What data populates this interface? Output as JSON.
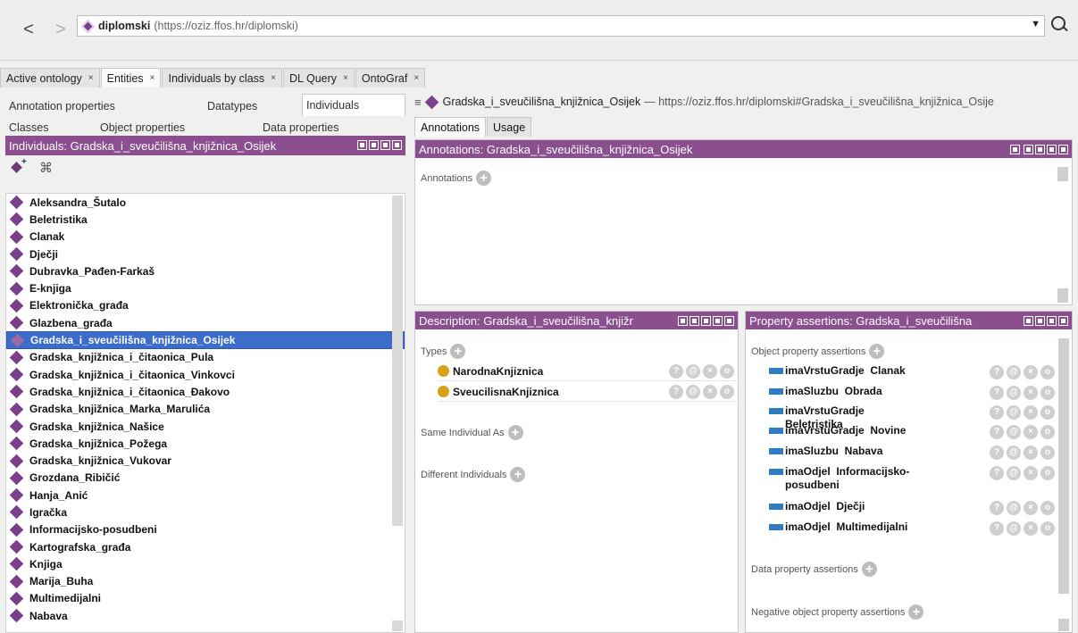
{
  "address": {
    "name": "diplomski",
    "iri": "(https://oziz.ffos.hr/diplomski)"
  },
  "tabs": [
    {
      "label": "Active ontology",
      "close": "×"
    },
    {
      "label": "Entities",
      "close": "×"
    },
    {
      "label": "Individuals by class",
      "close": "×"
    },
    {
      "label": "DL Query",
      "close": "×"
    },
    {
      "label": "OntoGraf",
      "close": "×"
    }
  ],
  "left": {
    "subtabs_row1": [
      "Annotation properties",
      "Datatypes",
      "Individuals"
    ],
    "subtabs_row2": [
      "Classes",
      "Object properties",
      "Data properties"
    ],
    "header": "Individuals: Gradska_i_sveučilišna_knjižnica_Osijek",
    "individuals": [
      "Aleksandra_Šutalo",
      "Beletristika",
      "Clanak",
      "Dječji",
      "Dubravka_Pađen-Farkaš",
      "E-knjiga",
      "Elektronička_građa",
      "Glazbena_građa",
      "Gradska_i_sveučilišna_knjižnica_Osijek",
      "Gradska_knjižnica_i_čitaonica_Pula",
      "Gradska_knjižnica_i_čitaonica_Vinkovci",
      "Gradska_knjižnica_i_čitaonica_Đakovo",
      "Gradska_knjižnica_Marka_Marulića",
      "Gradska_knjižnica_Našice",
      "Gradska_knjižnica_Požega",
      "Gradska_knjižnica_Vukovar",
      "Grozdana_Ribičić",
      "Hanja_Anić",
      "Igračka",
      "Informacijsko-posudbeni",
      "Kartografska_građa",
      "Knjiga",
      "Marija_Buha",
      "Multimedijalni",
      "Nabava"
    ],
    "selected_index": 8
  },
  "breadcrumb": {
    "name": "Gradska_i_sveučilišna_knjižnica_Osijek",
    "iri": "— https://oziz.ffos.hr/diplomski#Gradska_i_sveučilišna_knjižnica_Osije"
  },
  "right_tabs": [
    "Annotations",
    "Usage"
  ],
  "annotations": {
    "header": "Annotations: Gradska_i_sveučilišna_knjižnica_Osijek",
    "label": "Annotations"
  },
  "description": {
    "header": "Description: Gradska_i_sveučilišna_knjižr",
    "types_label": "Types",
    "types": [
      "NarodnaKnjiznica",
      "SveucilisnaKnjiznica"
    ],
    "same_label": "Same Individual As",
    "different_label": "Different Individuals"
  },
  "property_assertions": {
    "header": "Property assertions: Gradska_i_sveučilišna",
    "object_label": "Object property assertions",
    "object_assertions": [
      "imaVrstuGradje  Clanak",
      "imaSluzbu  Obrada",
      "imaVrstuGradje  Beletristika",
      "imaVrstuGradje  Novine",
      "imaSluzbu  Nabava",
      "imaOdjel  Informacijsko-posudbeni",
      "imaOdjel  Dječji",
      "imaOdjel  Multimedijalni"
    ],
    "data_label": "Data property assertions",
    "negative_label": "Negative object property assertions"
  },
  "row_buttons": [
    "?",
    "@",
    "×",
    "o"
  ],
  "colors": {
    "view_header": "#8b4f8f",
    "individual": "#7b3f8c",
    "selection": "#3d6dcc",
    "class_icon": "#d7a116",
    "object_property": "#2f7cc5"
  }
}
